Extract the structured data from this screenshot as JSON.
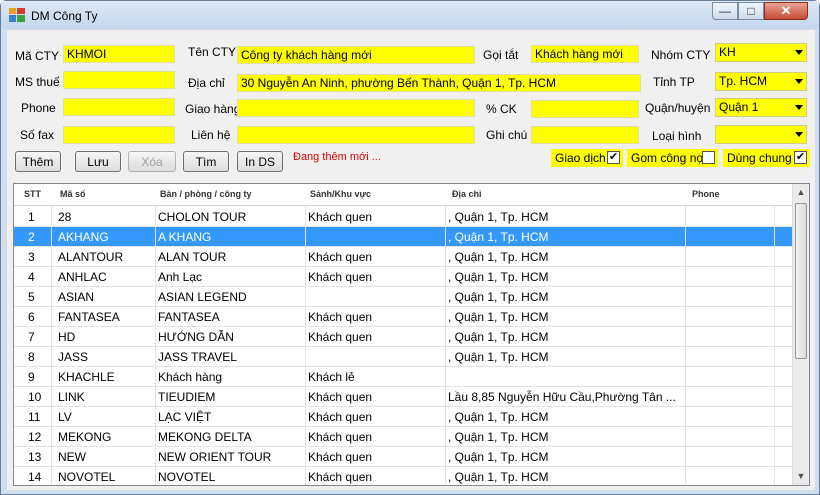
{
  "window": {
    "title": "DM Công Ty",
    "minimize": "—",
    "maximize": "□",
    "close": "✕"
  },
  "form": {
    "ma_cty": {
      "label": "Mã CTY",
      "value": "KHMOI"
    },
    "ten_cty": {
      "label": "Tên CTY",
      "value": "Công ty khách hàng mới"
    },
    "goi_tat": {
      "label": "Gọi tắt",
      "value": "Khách hàng mới"
    },
    "nhom_cty": {
      "label": "Nhóm CTY",
      "value": "KH"
    },
    "ms_thue": {
      "label": "MS thuế",
      "value": ""
    },
    "dia_chi": {
      "label": "Địa chỉ",
      "value": "30 Nguyễn An Ninh, phường Bến Thành, Quận 1, Tp. HCM"
    },
    "tinh_tp": {
      "label": "Tỉnh TP",
      "value": "Tp. HCM"
    },
    "phone": {
      "label": "Phone",
      "value": ""
    },
    "giao_hang": {
      "label": "Giao hàng",
      "value": ""
    },
    "pct_ck": {
      "label": "% CK",
      "value": ""
    },
    "quan_huyen": {
      "label": "Quận/huyện",
      "value": "Quận 1"
    },
    "so_fax": {
      "label": "Số fax",
      "value": ""
    },
    "lien_he": {
      "label": "Liên hệ",
      "value": ""
    },
    "ghi_chu": {
      "label": "Ghi chú",
      "value": ""
    },
    "loai_hinh": {
      "label": "Loại hình",
      "value": ""
    }
  },
  "buttons": {
    "them": "Thêm",
    "luu": "Lưu",
    "xoa": "Xóa",
    "tim": "Tìm",
    "in_ds": "In DS"
  },
  "status_text": "Đang thêm mới ...",
  "checkboxes": {
    "giao_dich": {
      "label": "Giao dịch",
      "checked": true,
      "mark": "✔"
    },
    "gom_cong_no": {
      "label": "Gom công nợ",
      "checked": false,
      "mark": ""
    },
    "dung_chung": {
      "label": "Dùng chung",
      "checked": true,
      "mark": "✔"
    }
  },
  "grid": {
    "columns": [
      "STT",
      "Mã số",
      "Bàn / phòng / công ty",
      "Sảnh/Khu vực",
      "Địa chỉ",
      "Phone"
    ],
    "rows": [
      {
        "stt": "1",
        "ma": "28",
        "ten": "CHOLON TOUR",
        "khu": "Khách quen",
        "diachi": ", Quận 1, Tp. HCM",
        "phone": ""
      },
      {
        "stt": "2",
        "ma": "AKHANG",
        "ten": "A KHANG",
        "khu": "",
        "diachi": ", Quận 1, Tp. HCM",
        "phone": ""
      },
      {
        "stt": "3",
        "ma": "ALANTOUR",
        "ten": "ALAN TOUR",
        "khu": "Khách quen",
        "diachi": ", Quận 1, Tp. HCM",
        "phone": ""
      },
      {
        "stt": "4",
        "ma": "ANHLAC",
        "ten": "Anh Lạc",
        "khu": "Khách quen",
        "diachi": ", Quận 1, Tp. HCM",
        "phone": ""
      },
      {
        "stt": "5",
        "ma": "ASIAN",
        "ten": "ASIAN LEGEND",
        "khu": "",
        "diachi": ", Quận 1, Tp. HCM",
        "phone": ""
      },
      {
        "stt": "6",
        "ma": "FANTASEA",
        "ten": "FANTASEA",
        "khu": "Khách quen",
        "diachi": ", Quận 1, Tp. HCM",
        "phone": ""
      },
      {
        "stt": "7",
        "ma": "HD",
        "ten": "HƯỚNG DẪN",
        "khu": "Khách quen",
        "diachi": ", Quận 1, Tp. HCM",
        "phone": ""
      },
      {
        "stt": "8",
        "ma": "JASS",
        "ten": "JASS TRAVEL",
        "khu": "",
        "diachi": ", Quận 1, Tp. HCM",
        "phone": ""
      },
      {
        "stt": "9",
        "ma": "KHACHLE",
        "ten": "Khách hàng",
        "khu": "Khách lẻ",
        "diachi": "",
        "phone": ""
      },
      {
        "stt": "10",
        "ma": "LINK",
        "ten": "TIEUDIEM",
        "khu": "Khách quen",
        "diachi": "Lầu 8,85 Nguyễn Hữu Cầu,Phường Tân ...",
        "phone": ""
      },
      {
        "stt": "11",
        "ma": "LV",
        "ten": "LẠC VIỆT",
        "khu": "Khách quen",
        "diachi": ", Quận 1, Tp. HCM",
        "phone": ""
      },
      {
        "stt": "12",
        "ma": "MEKONG",
        "ten": "MEKONG DELTA",
        "khu": "Khách quen",
        "diachi": ", Quận 1, Tp. HCM",
        "phone": ""
      },
      {
        "stt": "13",
        "ma": "NEW",
        "ten": "NEW ORIENT TOUR",
        "khu": "Khách quen",
        "diachi": ", Quận 1, Tp. HCM",
        "phone": ""
      },
      {
        "stt": "14",
        "ma": "NOVOTEL",
        "ten": "NOVOTEL",
        "khu": "Khách quen",
        "diachi": ", Quận 1, Tp. HCM",
        "phone": ""
      }
    ],
    "selected_row": 1
  },
  "scroll": {
    "up": "▲",
    "down": "▼"
  },
  "colors": {
    "field_bg": "#ffff00",
    "selected_row": "#3399ff",
    "status": "#e00000"
  }
}
